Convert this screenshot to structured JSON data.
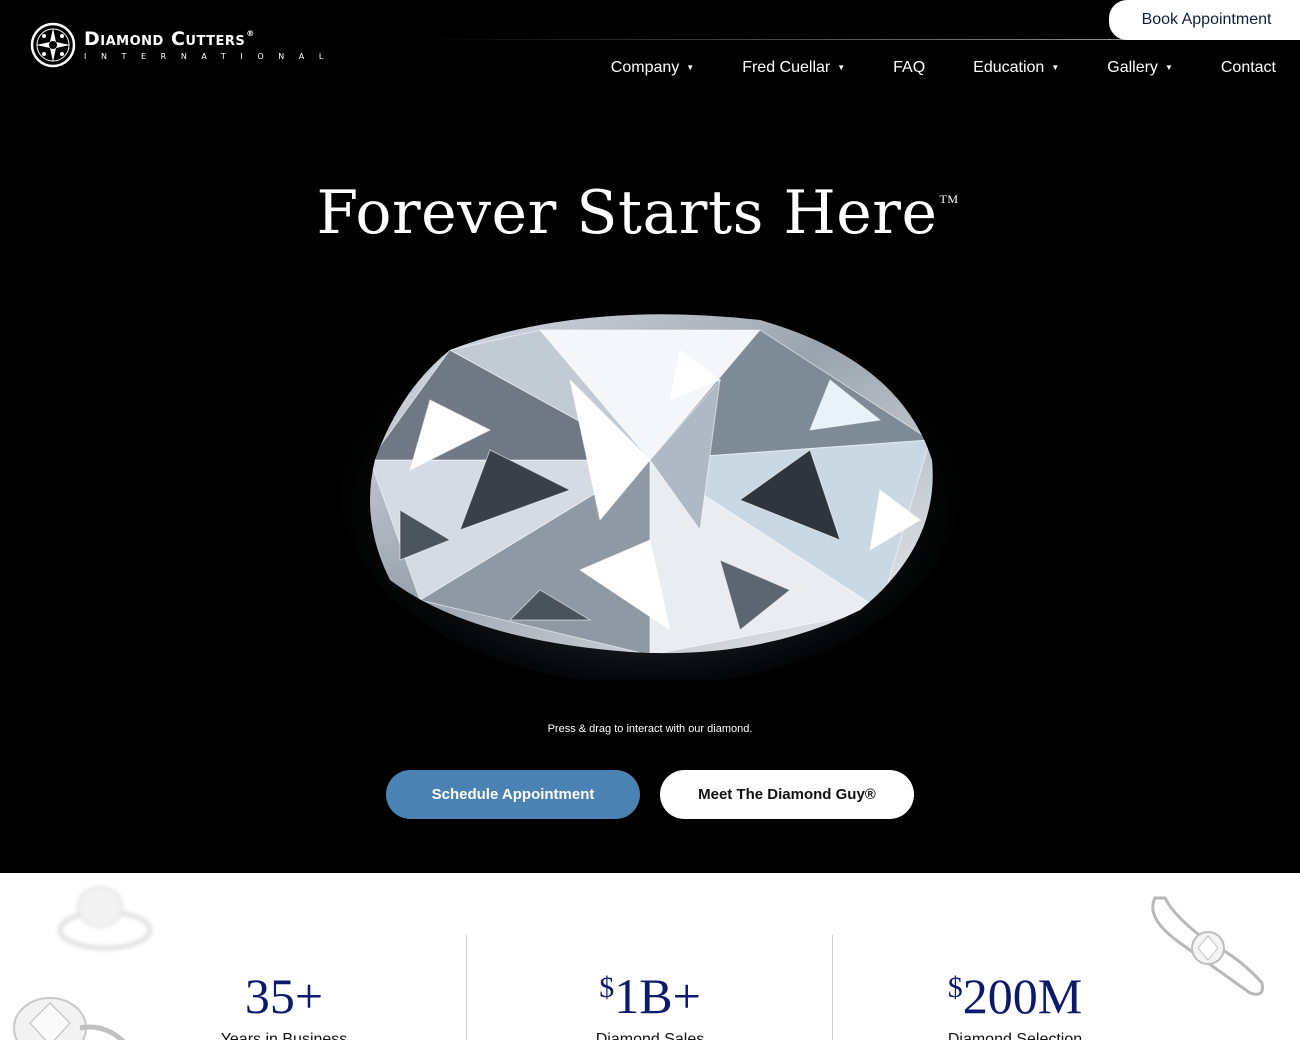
{
  "brand": {
    "name": "Diamond Cutters",
    "registered": "®",
    "subtitle": "INTERNATIONAL"
  },
  "header": {
    "book_label": "Book Appointment",
    "nav": [
      {
        "label": "Company",
        "has_dropdown": true
      },
      {
        "label": "Fred Cuellar",
        "has_dropdown": true
      },
      {
        "label": "FAQ",
        "has_dropdown": false
      },
      {
        "label": "Education",
        "has_dropdown": true
      },
      {
        "label": "Gallery",
        "has_dropdown": true
      },
      {
        "label": "Contact",
        "has_dropdown": false
      }
    ]
  },
  "hero": {
    "title": "Forever Starts Here",
    "trademark": "TM",
    "hint": "Press & drag to interact with our diamond.",
    "schedule_label": "Schedule Appointment",
    "meet_label": "Meet The Diamond Guy®"
  },
  "stats": [
    {
      "currency": "",
      "value": "35+",
      "label": "Years in Business"
    },
    {
      "currency": "$",
      "value": "1B+",
      "label": "Diamond Sales"
    },
    {
      "currency": "$",
      "value": "200M",
      "label": "Diamond Selection"
    }
  ],
  "colors": {
    "background": "#000000",
    "primary_button": "#4a83b3",
    "stat_number": "#0b1a6b",
    "book_text": "#0f1f3d"
  },
  "icons": {
    "logo": "compass-diamond-icon",
    "caret": "caret-down-icon"
  }
}
